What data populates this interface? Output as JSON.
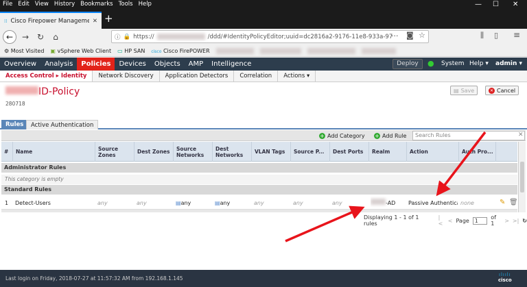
{
  "browser": {
    "menu": [
      "File",
      "Edit",
      "View",
      "History",
      "Bookmarks",
      "Tools",
      "Help"
    ],
    "tab_title": "Cisco Firepower Management",
    "url_prefix": "https://",
    "url_path": "/ddd/#IdentityPolicyEditor;uuid=dc2816a2-9176-11e8-933a-97",
    "url_more": "···",
    "bookmarks": [
      "Most Visited",
      "vSphere Web Client",
      "HP SAN",
      "Cisco FirePOWER"
    ]
  },
  "appnav": {
    "items": [
      "Overview",
      "Analysis",
      "Policies",
      "Devices",
      "Objects",
      "AMP",
      "Intelligence"
    ],
    "deploy": "Deploy",
    "system": "System",
    "help": "Help ▾",
    "user": "admin ▾"
  },
  "subnav": {
    "items": [
      "Access Control ▸ Identity",
      "Network Discovery",
      "Application Detectors",
      "Correlation",
      "Actions ▾"
    ]
  },
  "policy": {
    "name_suffix": "ID-Policy",
    "sub": "280718",
    "save": "Save",
    "cancel": "Cancel"
  },
  "policy_tabs": [
    "Rules",
    "Active Authentication"
  ],
  "toolbar": {
    "add_category": "Add Category",
    "add_rule": "Add Rule",
    "search_placeholder": "Search Rules"
  },
  "table": {
    "headers": [
      "#",
      "Name",
      "Source Zones",
      "Dest Zones",
      "Source Networks",
      "Dest Networks",
      "VLAN Tags",
      "Source P...",
      "Dest Ports",
      "Realm",
      "Action",
      "Auth Pro..."
    ],
    "sections": {
      "admin": "Administrator Rules",
      "admin_empty": "This category is empty",
      "standard": "Standard Rules"
    },
    "row": {
      "num": "1",
      "name": "Detect-Users",
      "src_zones": "any",
      "dst_zones": "any",
      "src_net": "any",
      "dst_net": "any",
      "vlan": "any",
      "src_ports": "any",
      "dst_ports": "any",
      "realm_suffix": "-AD",
      "action": "Passive Authentical",
      "auth": "none"
    }
  },
  "pager": {
    "summary": "Displaying 1 - 1 of 1 rules",
    "page_label": "Page",
    "page_value": "1",
    "of": "of 1"
  },
  "footer": {
    "last_login": "Last login on Friday, 2018-07-27 at 11:57:32 AM from 192.168.1.145",
    "logo": "cisco"
  },
  "colors": {
    "accent": "#c8102e",
    "nav": "#2d3d4d",
    "arrow": "#e8141b"
  }
}
